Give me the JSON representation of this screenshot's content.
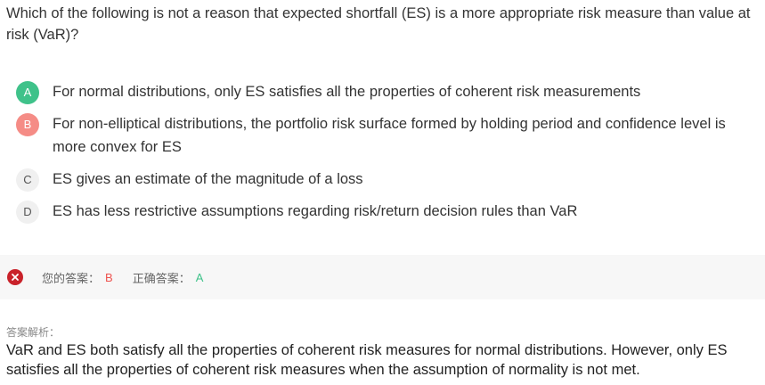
{
  "question": "Which of the following is not a reason that expected shortfall (ES) is a more appropriate risk measure than value at risk (VaR)?",
  "options": [
    {
      "letter": "A",
      "text": "For normal distributions, only ES satisfies all the properties of coherent risk measurements",
      "state": "correct"
    },
    {
      "letter": "B",
      "text": "For non-elliptical distributions, the portfolio risk surface formed by holding period and confidence level is more convex for ES",
      "state": "wrong"
    },
    {
      "letter": "C",
      "text": "ES gives an estimate of the magnitude of a loss",
      "state": "neutral"
    },
    {
      "letter": "D",
      "text": "ES has less restrictive assumptions regarding risk/return decision rules than VaR",
      "state": "neutral"
    }
  ],
  "result": {
    "your_answer_label": "您的答案：",
    "your_answer": "B",
    "correct_answer_label": "正确答案：",
    "correct_answer": "A"
  },
  "analysis": {
    "label": "答案解析：",
    "text": "VaR and ES both satisfy all the properties of coherent risk measures for normal distributions. However, only ES satisfies all the properties of coherent risk measures when the assumption of normality is not met."
  },
  "colors": {
    "correct": "#3fc28a",
    "wrong": "#f58c86",
    "error_icon": "#c9222a"
  }
}
